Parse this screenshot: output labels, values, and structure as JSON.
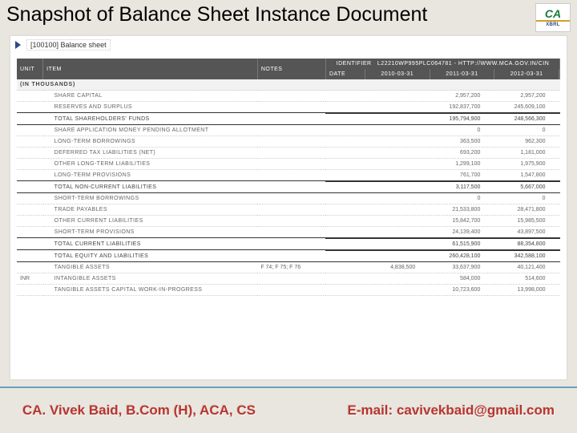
{
  "header": {
    "title": "Snapshot of Balance Sheet Instance Document",
    "logo_top": "CA",
    "logo_mid": "XBRL"
  },
  "sheet": {
    "code_title": "[100100] Balance sheet",
    "col_unit": "UNIT",
    "col_item": "ITEM",
    "col_notes": "NOTES",
    "col_identifier": "IDENTIFIER",
    "col_date": "DATE",
    "identifier_value": "L22210WP995PLC064781 - HTTP://WWW.MCA.GOV.IN/CIN",
    "in_thousands": "(IN THOUSANDS)",
    "inr": "INR",
    "dates": [
      "2010-03-31",
      "2011-03-31",
      "2012-03-31"
    ],
    "rows": [
      {
        "item": "SHARE CAPITAL",
        "v1": "",
        "v2": "2,957,200",
        "v3": "2,957,200"
      },
      {
        "item": "RESERVES AND SURPLUS",
        "v1": "",
        "v2": "192,837,700",
        "v3": "245,609,100"
      },
      {
        "item": "TOTAL SHAREHOLDERS' FUNDS",
        "total": true,
        "v1": "",
        "v2": "195,794,900",
        "v3": "248,566,300"
      },
      {
        "item": "SHARE APPLICATION MONEY PENDING ALLOTMENT",
        "v1": "",
        "v2": "0",
        "v3": "0"
      },
      {
        "item": "LONG-TERM BORROWINGS",
        "v1": "",
        "v2": "363,500",
        "v3": "962,300"
      },
      {
        "item": "DEFERRED TAX LIABILITIES (NET)",
        "v1": "",
        "v2": "693,200",
        "v3": "1,181,000"
      },
      {
        "item": "OTHER LONG-TERM LIABILITIES",
        "v1": "",
        "v2": "1,299,100",
        "v3": "1,975,900"
      },
      {
        "item": "LONG-TERM PROVISIONS",
        "v1": "",
        "v2": "761,700",
        "v3": "1,547,800"
      },
      {
        "item": "TOTAL NON-CURRENT LIABILITIES",
        "total": true,
        "v1": "",
        "v2": "3,117,500",
        "v3": "5,667,000"
      },
      {
        "item": "SHORT-TERM BORROWINGS",
        "v1": "",
        "v2": "0",
        "v3": "0"
      },
      {
        "item": "TRADE PAYABLES",
        "v1": "",
        "v2": "21,533,800",
        "v3": "28,471,800"
      },
      {
        "item": "OTHER CURRENT LIABILITIES",
        "v1": "",
        "v2": "15,842,700",
        "v3": "15,985,500"
      },
      {
        "item": "SHORT-TERM PROVISIONS",
        "v1": "",
        "v2": "24,139,400",
        "v3": "43,897,500"
      },
      {
        "item": "TOTAL CURRENT LIABILITIES",
        "total": true,
        "v1": "",
        "v2": "61,515,900",
        "v3": "88,354,800"
      },
      {
        "item": "TOTAL EQUITY AND LIABILITIES",
        "total": true,
        "v1": "",
        "v2": "260,428,100",
        "v3": "342,588,100"
      },
      {
        "item": "TANGIBLE ASSETS",
        "notes": "F 74; F 75; F 76",
        "v1": "4,838,500",
        "v2": "33,637,900",
        "v3": "40,121,400"
      },
      {
        "item": "INTANGIBLE ASSETS",
        "v1": "",
        "v2": "584,000",
        "v3": "514,600"
      },
      {
        "item": "TANGIBLE ASSETS CAPITAL WORK-IN-PROGRESS",
        "v1": "",
        "v2": "10,723,600",
        "v3": "13,998,000"
      }
    ]
  },
  "footer": {
    "left": "CA. Vivek Baid, B.Com (H), ACA, CS",
    "right_label": "E-mail:",
    "right_email": "cavivekbaid@gmail.com"
  }
}
